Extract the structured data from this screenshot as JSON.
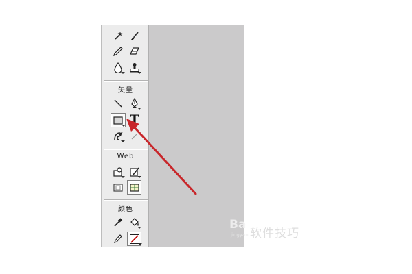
{
  "toolbox": {
    "sections": {
      "vector_label": "矢量",
      "web_label": "Web",
      "colors_label": "颜色"
    },
    "tools": {
      "text_tool_glyph": "T"
    },
    "active_tool": "rectangle-tool",
    "stroke_color": "#c00000"
  },
  "annotation": {
    "arrow_color": "#c8262a",
    "points_to": "rectangle-tool"
  },
  "watermark": {
    "logo_text": "Ba",
    "caption": "软件技巧",
    "sub_text": "jingyan"
  }
}
